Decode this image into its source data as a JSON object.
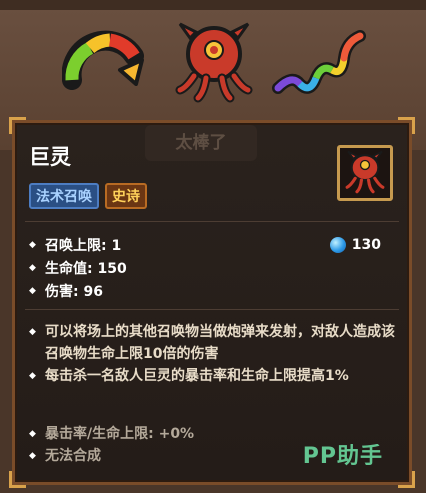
{
  "top_slots": [
    {
      "icon": "speed-gauge-icon"
    },
    {
      "icon": "octopus-giant-icon"
    },
    {
      "icon": "rainbow-snake-icon"
    }
  ],
  "ghost_button": {
    "label": "太棒了"
  },
  "card": {
    "title": "巨灵",
    "tags": [
      "法术召唤",
      "史诗"
    ],
    "stats": [
      {
        "label": "召唤上限: 1"
      },
      {
        "label": "生命值: 150"
      },
      {
        "label": "伤害: 96"
      }
    ],
    "mana_cost": "130",
    "description": [
      "可以将场上的其他召唤物当做炮弹来发射，对敌人造成该召唤物生命上限10倍的伤害",
      "每击杀一名敌人巨灵的暴击率和生命上限提高1%"
    ],
    "extras": [
      "暴击率/生命上限: +0%",
      "无法合成"
    ]
  },
  "watermark": "PP助手",
  "colors": {
    "epic_tag": "#ffd15a",
    "spell_tag": "#a9d2ff",
    "frame": "#7a4c29",
    "mana": "#2d9ae8"
  }
}
